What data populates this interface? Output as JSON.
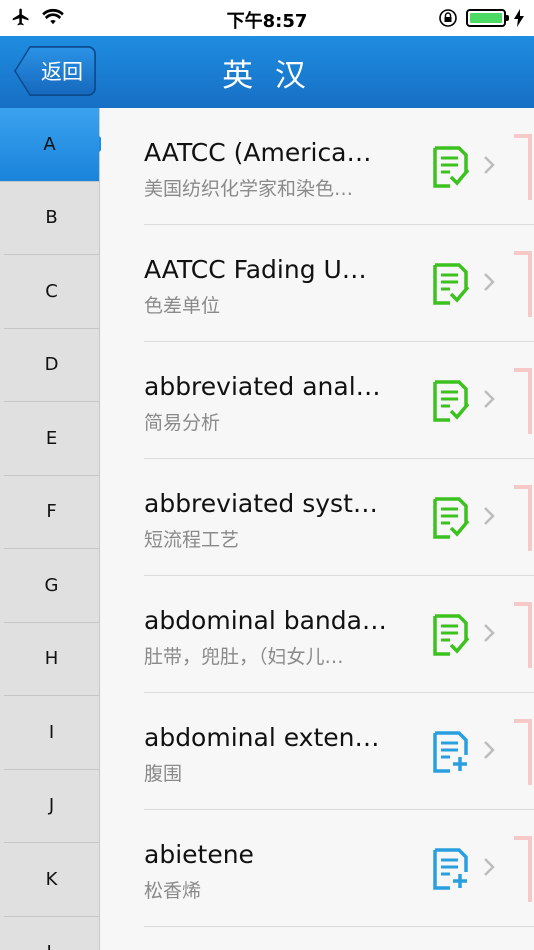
{
  "status": {
    "time": "下午8:57"
  },
  "nav": {
    "back_label": "返回",
    "title": "英 汉"
  },
  "sidebar": {
    "letters": [
      "A",
      "B",
      "C",
      "D",
      "E",
      "F",
      "G",
      "H",
      "I",
      "J",
      "K",
      "L"
    ],
    "active": "A"
  },
  "entries": [
    {
      "term": "AATCC (America…",
      "translation": "美国纺织化学家和染色…",
      "status": "added"
    },
    {
      "term": "AATCC Fading U…",
      "translation": "色差单位",
      "status": "added"
    },
    {
      "term": "abbreviated anal…",
      "translation": "简易分析",
      "status": "added"
    },
    {
      "term": "abbreviated syst…",
      "translation": "短流程工艺",
      "status": "added"
    },
    {
      "term": "abdominal banda…",
      "translation": "肚带，兜肚，（妇女儿…",
      "status": "added"
    },
    {
      "term": "abdominal exten…",
      "translation": "腹围",
      "status": "add"
    },
    {
      "term": "abietene",
      "translation": "松香烯",
      "status": "add"
    }
  ],
  "colors": {
    "nav": "#1a7fd4",
    "added": "#3cc21f",
    "add": "#2a9fe0"
  },
  "icons": {
    "added": "note-check-icon",
    "add": "note-plus-icon"
  }
}
